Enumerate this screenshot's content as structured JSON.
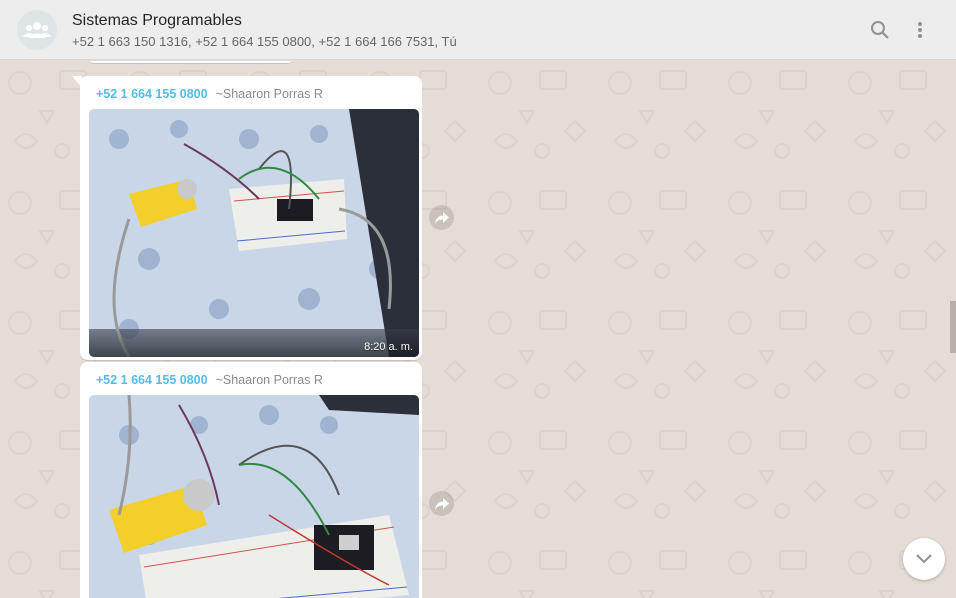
{
  "header": {
    "title": "Sistemas Programables",
    "members": "+52 1 663 150 1316, +52 1 664 155 0800, +52 1 664 166 7531, Tú",
    "avatar_icon": "group-icon",
    "search_icon": "search-icon",
    "menu_icon": "kebab-menu-icon"
  },
  "messages": [
    {
      "sender_phone": "+52 1 664 155 0800",
      "sender_name": "~Shaaron Porras R",
      "time": "8:20 a. m.",
      "type": "image"
    },
    {
      "sender_phone": "+52 1 664 155 0800",
      "sender_name": "~Shaaron Porras R",
      "type": "image"
    }
  ],
  "colors": {
    "header_bg": "#ededed",
    "chat_bg": "#e5ddd5",
    "sender_phone": "#53bdeb",
    "bubble_bg": "#ffffff"
  }
}
